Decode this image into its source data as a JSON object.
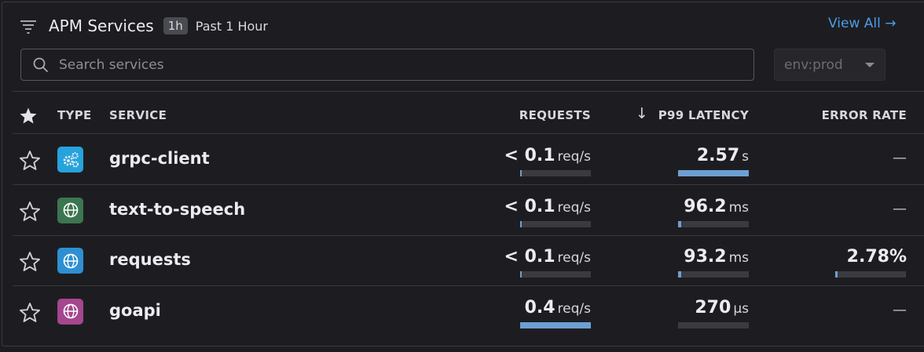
{
  "header": {
    "title": "APM Services",
    "time_badge": "1h",
    "time_label": "Past 1 Hour",
    "view_all": "View All →"
  },
  "search": {
    "placeholder": "Search services",
    "value": ""
  },
  "env_select": {
    "value": "env:prod"
  },
  "columns": {
    "type": "TYPE",
    "service": "SERVICE",
    "requests": "REQUESTS",
    "sort_arrow": "↓",
    "latency": "P99 LATENCY",
    "error_rate": "ERROR RATE"
  },
  "colors": {
    "accent": "#4d9be6",
    "bar_fill": "#6e9fd2",
    "grpc_icon_bg": "#27a3dc",
    "web_icon_green_bg": "#3c7650",
    "web_icon_blue_bg": "#2e8fd2",
    "web_icon_purple_bg": "#a5468e"
  },
  "rows": [
    {
      "service": "grpc-client",
      "icon": "gears-icon",
      "requests": {
        "prefix": "< ",
        "value": "0.1",
        "unit": "req/s",
        "fraction": 0.02
      },
      "latency": {
        "value": "2.57",
        "unit": "s",
        "fraction": 1.0
      },
      "error_rate": {
        "text": "—",
        "fraction": null
      }
    },
    {
      "service": "text-to-speech",
      "icon": "globe-icon",
      "requests": {
        "prefix": "< ",
        "value": "0.1",
        "unit": "req/s",
        "fraction": 0.02
      },
      "latency": {
        "value": "96.2",
        "unit": "ms",
        "fraction": 0.04
      },
      "error_rate": {
        "text": "—",
        "fraction": null
      }
    },
    {
      "service": "requests",
      "icon": "globe-icon",
      "requests": {
        "prefix": "< ",
        "value": "0.1",
        "unit": "req/s",
        "fraction": 0.02
      },
      "latency": {
        "value": "93.2",
        "unit": "ms",
        "fraction": 0.04
      },
      "error_rate": {
        "text": "2.78%",
        "fraction": 0.03
      }
    },
    {
      "service": "goapi",
      "icon": "globe-icon",
      "requests": {
        "prefix": "",
        "value": "0.4",
        "unit": "req/s",
        "fraction": 1.0
      },
      "latency": {
        "value": "270",
        "unit": "µs",
        "fraction": 0.0
      },
      "error_rate": {
        "text": "—",
        "fraction": null
      }
    }
  ]
}
